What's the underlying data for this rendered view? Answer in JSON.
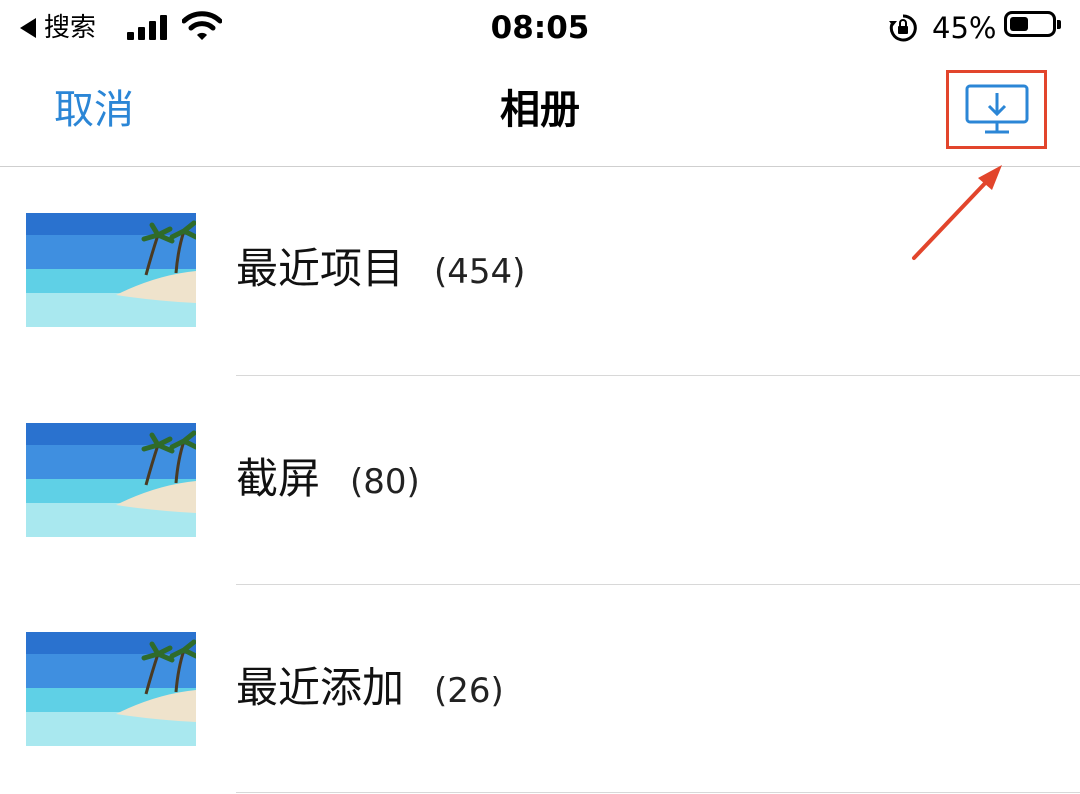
{
  "status_bar": {
    "back_label": "搜索",
    "time": "08:05",
    "battery_percent": "45%",
    "battery_level": 0.45,
    "icons": [
      "back-arrow-icon",
      "signal-icon",
      "wifi-icon",
      "rotation-lock-icon",
      "battery-icon"
    ]
  },
  "nav": {
    "cancel_label": "取消",
    "title": "相册",
    "action_icon": "desktop-download-icon",
    "action_highlight_color": "#e2452c"
  },
  "albums": [
    {
      "name": "最近项目",
      "count": "(454)"
    },
    {
      "name": "截屏",
      "count": "(80)"
    },
    {
      "name": "最近添加",
      "count": "(26)"
    }
  ],
  "colors": {
    "accent": "#2b86d6",
    "annotation": "#e2452c"
  }
}
